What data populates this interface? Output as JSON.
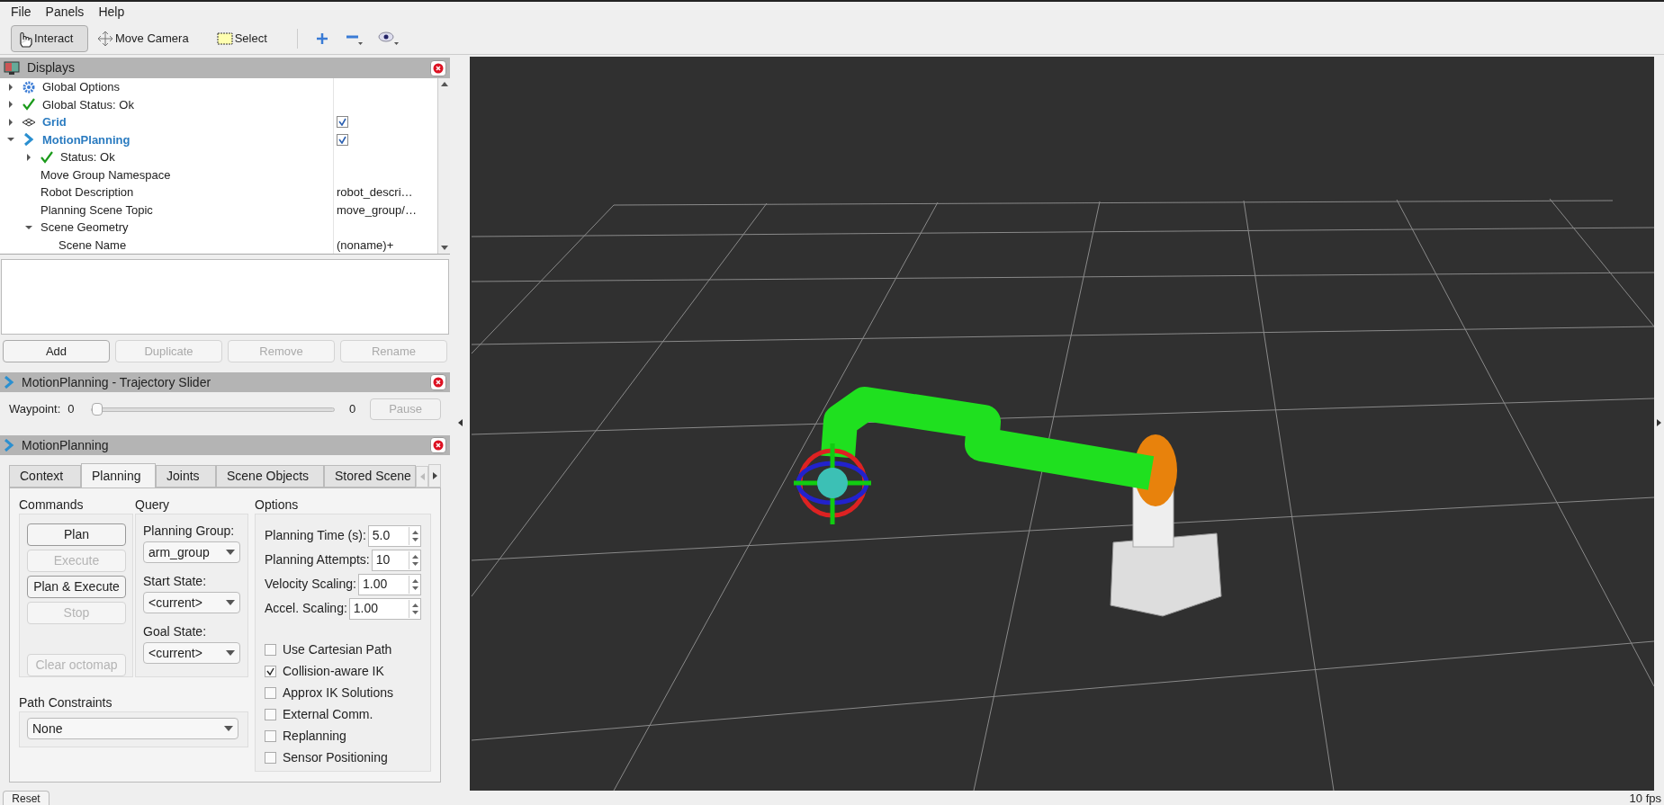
{
  "menu": [
    "File",
    "Panels",
    "Help"
  ],
  "toolbar": {
    "tools": [
      {
        "kind": "interact",
        "label": "Interact",
        "selected": true
      },
      {
        "kind": "camera",
        "label": "Move Camera",
        "selected": false
      },
      {
        "kind": "select",
        "label": "Select",
        "selected": false
      }
    ]
  },
  "displays": {
    "title": "Displays",
    "tree": [
      {
        "label": "Global Options",
        "kind": "gear",
        "expanded": false
      },
      {
        "label": "Global Status: Ok",
        "kind": "check",
        "expanded": false
      },
      {
        "label": "Grid",
        "kind": "grid",
        "expanded": false,
        "checked": true
      },
      {
        "label": "MotionPlanning",
        "kind": "chevron",
        "expanded": true,
        "checked": true,
        "children": [
          {
            "label": "Status: Ok",
            "kind": "check",
            "expanded": false
          },
          {
            "label": "Move Group Namespace"
          },
          {
            "label": "Robot Description",
            "value": "robot_descri…"
          },
          {
            "label": "Planning Scene Topic",
            "value": "move_group/…"
          },
          {
            "label": "Scene Geometry",
            "expanded": true,
            "children": [
              {
                "label": "Scene Name",
                "value": "(noname)+"
              }
            ]
          }
        ]
      }
    ],
    "buttons": [
      {
        "label": "Add",
        "disabled": false
      },
      {
        "label": "Duplicate",
        "disabled": true
      },
      {
        "label": "Remove",
        "disabled": true
      },
      {
        "label": "Rename",
        "disabled": true
      }
    ]
  },
  "trajectory_panel": {
    "title": "MotionPlanning - Trajectory Slider",
    "waypoint_label": "Waypoint:",
    "waypoint_value": "0",
    "level": 0,
    "max_value": "0",
    "pause": {
      "label": "Pause",
      "disabled": true
    }
  },
  "motion_panel": {
    "title": "MotionPlanning",
    "tabs": [
      {
        "label": "Context",
        "selected": false
      },
      {
        "label": "Planning",
        "selected": true
      },
      {
        "label": "Joints",
        "selected": false
      },
      {
        "label": "Scene Objects",
        "selected": false
      },
      {
        "label": "Stored Scene",
        "selected": false
      }
    ],
    "commands": {
      "title": "Commands",
      "buttons": [
        {
          "label": "Plan",
          "disabled": false
        },
        {
          "label": "Execute",
          "disabled": true
        },
        {
          "label": "Plan & Execute",
          "disabled": false
        },
        {
          "label": "Stop",
          "disabled": true
        },
        {
          "label": "Clear octomap",
          "disabled": true
        }
      ]
    },
    "query": {
      "title": "Query",
      "fields": [
        {
          "label": "Planning Group:",
          "value": "arm_group"
        },
        {
          "label": "Start State:",
          "value": "<current>"
        },
        {
          "label": "Goal State:",
          "value": "<current>"
        }
      ]
    },
    "options": {
      "title": "Options",
      "spinboxes": [
        {
          "label": "Planning Time (s):",
          "value": "5.0"
        },
        {
          "label": "Planning Attempts:",
          "value": "10"
        },
        {
          "label": "Velocity Scaling:",
          "value": "1.00"
        },
        {
          "label": "Accel. Scaling:",
          "value": "1.00"
        }
      ],
      "checkboxes": [
        {
          "label": "Use Cartesian Path",
          "checked": false
        },
        {
          "label": "Collision-aware IK",
          "checked": true
        },
        {
          "label": "Approx IK Solutions",
          "checked": false
        },
        {
          "label": "External Comm.",
          "checked": false
        },
        {
          "label": "Replanning",
          "checked": false
        },
        {
          "label": "Sensor Positioning",
          "checked": false
        }
      ]
    },
    "path_constraints": {
      "title": "Path Constraints",
      "value": "None"
    }
  },
  "status_bar": {
    "reset": "Reset",
    "fps": "10 fps"
  }
}
